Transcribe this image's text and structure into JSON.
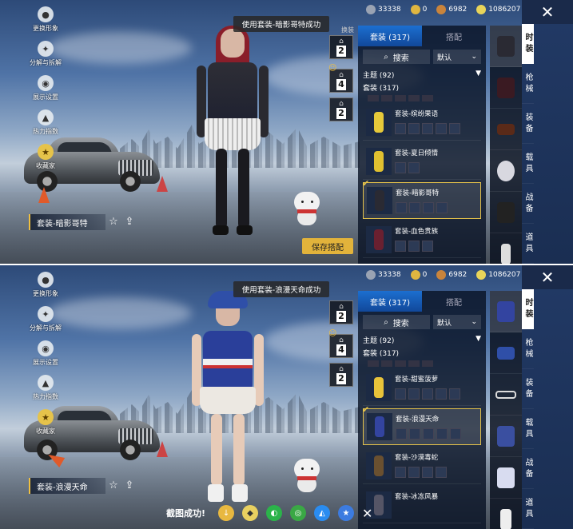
{
  "resources": [
    {
      "icon": "silver-coin-icon",
      "value": "33338",
      "color": "#9aa3b3"
    },
    {
      "icon": "gold-coin-icon",
      "value": "0",
      "color": "#e0b640"
    },
    {
      "icon": "bronze-coin-icon",
      "value": "6982",
      "color": "#c9843c"
    },
    {
      "icon": "uc-coin-icon",
      "value": "1086207",
      "color": "#e8d45a"
    }
  ],
  "left_menu": [
    {
      "icon": "avatar-icon",
      "label": "更换形象"
    },
    {
      "icon": "share-icon",
      "label": "分解与拆解"
    },
    {
      "icon": "eye-icon",
      "label": "展示设置"
    },
    {
      "icon": "fire-icon",
      "label": "热力指数"
    },
    {
      "icon": "collection-icon",
      "label": "收藏家"
    }
  ],
  "hangers": [
    "2",
    "4",
    "2"
  ],
  "hanger_label": "换装",
  "tabs": {
    "suits": "套装 (317)",
    "match": "搭配"
  },
  "search": {
    "label": "搜索",
    "sort": "默认"
  },
  "theme_row": "主题 (92)",
  "suit_row": "套装 (317)",
  "categories": [
    "时装",
    "枪械",
    "装备",
    "载具",
    "战备",
    "道具"
  ],
  "save_button": "保存搭配",
  "screenshot_success": "截图成功!",
  "colors": {
    "accent": "#1c6fd0",
    "gold": "#e6c34a",
    "panel": "#0a1426"
  },
  "panes": [
    {
      "toast": "使用套装-暗影哥特成功",
      "nameplate": "套装-暗影哥特",
      "items": [
        {
          "name": "套装-缤纷果语",
          "selected": false,
          "color": "#e6c93a"
        },
        {
          "name": "套装-夏日倾情",
          "selected": false,
          "color": "#e0c030"
        },
        {
          "name": "套装-暗影哥特",
          "selected": true,
          "color": "#2a2a33"
        },
        {
          "name": "套装-血色贵族",
          "selected": false,
          "color": "#4a1a22"
        }
      ]
    },
    {
      "toast": "使用套装-浪漫天命成功",
      "nameplate": "套装-浪漫天命",
      "items": [
        {
          "name": "套装-甜蜜菠萝",
          "selected": false,
          "color": "#e8c33a"
        },
        {
          "name": "套装-浪漫天命",
          "selected": true,
          "color": "#3344a0"
        },
        {
          "name": "套装-沙漠毒蛇",
          "selected": false,
          "color": "#6a5030"
        },
        {
          "name": "套装-冰冻风暴",
          "selected": false,
          "color": "#556"
        }
      ]
    }
  ]
}
